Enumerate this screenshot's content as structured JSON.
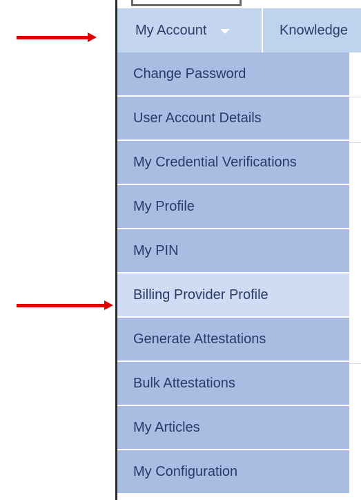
{
  "navbar": {
    "account_label": "My Account",
    "knowledge_label": "Knowledge"
  },
  "menu": {
    "items": [
      {
        "label": "Change Password"
      },
      {
        "label": "User Account Details"
      },
      {
        "label": "My Credential Verifications"
      },
      {
        "label": "My Profile"
      },
      {
        "label": "My PIN"
      },
      {
        "label": "Billing Provider Profile"
      },
      {
        "label": "Generate Attestations"
      },
      {
        "label": "Bulk Attestations"
      },
      {
        "label": "My Articles"
      },
      {
        "label": "My Configuration"
      }
    ],
    "highlighted_index": 5
  },
  "annotations": {
    "arrow_color": "#e00000"
  },
  "colors": {
    "menu_item": "#a9bde3",
    "menu_item_highlight": "#cfdcf4",
    "navbar": "#c3d5ef",
    "text": "#2a3a66"
  },
  "icons": {
    "dropdown": "caret-down-icon",
    "annotation": "red-arrow-icon"
  }
}
